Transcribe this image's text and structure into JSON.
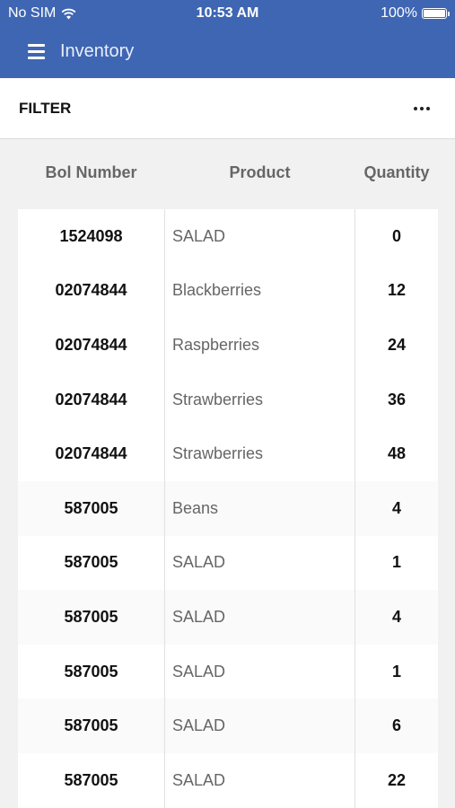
{
  "status_bar": {
    "carrier": "No SIM",
    "time": "10:53 AM",
    "battery": "100%"
  },
  "app_bar": {
    "title": "Inventory"
  },
  "filter_bar": {
    "label": "FILTER",
    "more_icon": "ellipsis-icon"
  },
  "table": {
    "columns": [
      "Bol Number",
      "Product",
      "Quantity"
    ],
    "rows": [
      {
        "bol": "1524098",
        "product": "SALAD",
        "quantity": "0"
      },
      {
        "bol": "02074844",
        "product": "Blackberries",
        "quantity": "12"
      },
      {
        "bol": "02074844",
        "product": "Raspberries",
        "quantity": "24"
      },
      {
        "bol": "02074844",
        "product": "Strawberries",
        "quantity": "36"
      },
      {
        "bol": "02074844",
        "product": "Strawberries",
        "quantity": "48"
      },
      {
        "bol": "587005",
        "product": "Beans",
        "quantity": "4"
      },
      {
        "bol": "587005",
        "product": "SALAD",
        "quantity": "1"
      },
      {
        "bol": "587005",
        "product": "SALAD",
        "quantity": "4"
      },
      {
        "bol": "587005",
        "product": "SALAD",
        "quantity": "1"
      },
      {
        "bol": "587005",
        "product": "SALAD",
        "quantity": "6"
      },
      {
        "bol": "587005",
        "product": "SALAD",
        "quantity": "22"
      }
    ]
  }
}
